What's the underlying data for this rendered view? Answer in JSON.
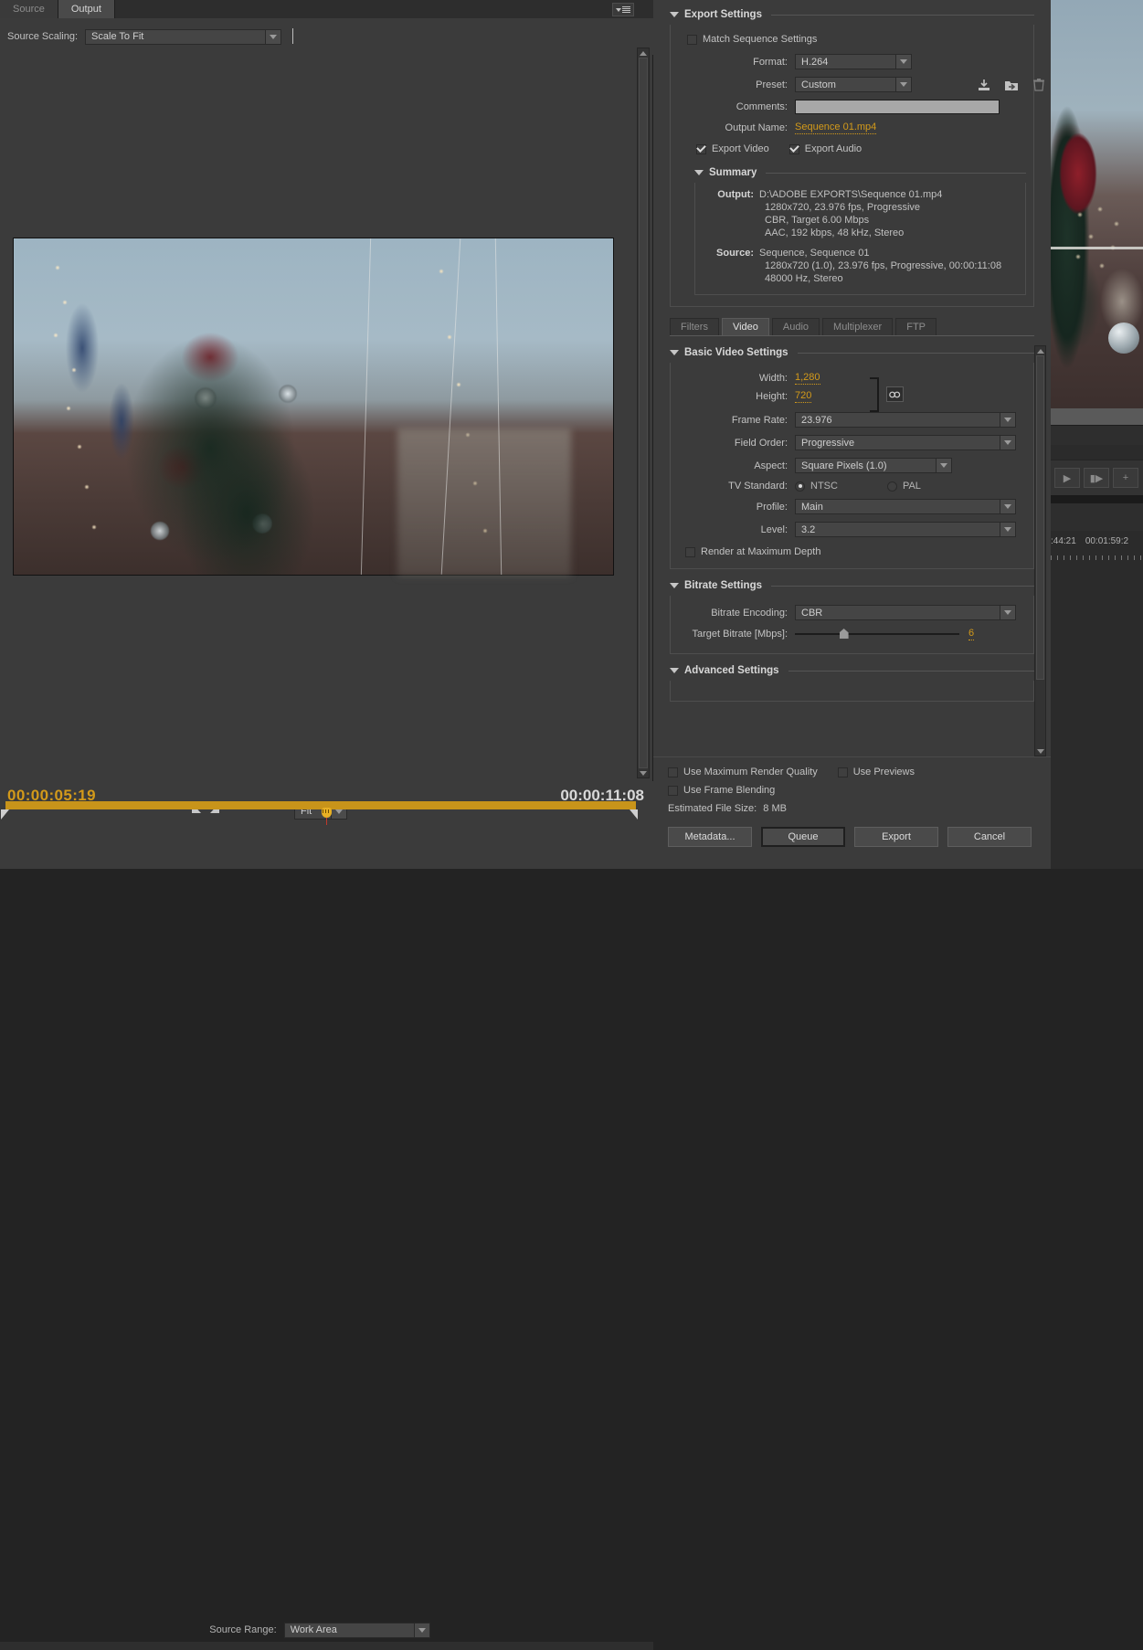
{
  "preview_panel": {
    "tabs": [
      {
        "label": "Source",
        "active": false
      },
      {
        "label": "Output",
        "active": true
      }
    ],
    "panel_menu_icon": "panel-menu-icon",
    "source_scaling_label": "Source Scaling:",
    "source_scaling_value": "Scale To Fit",
    "current_timecode": "00:00:05:19",
    "duration_timecode": "00:00:11:08",
    "zoom_level": "Fit",
    "source_range_label": "Source Range:",
    "source_range_value": "Work Area"
  },
  "export_settings": {
    "title": "Export Settings",
    "match_sequence_label": "Match Sequence Settings",
    "match_sequence_checked": false,
    "format_label": "Format:",
    "format_value": "H.264",
    "preset_label": "Preset:",
    "preset_value": "Custom",
    "preset_icons": [
      "save-preset-icon",
      "import-preset-icon",
      "delete-preset-icon"
    ],
    "comments_label": "Comments:",
    "comments_value": "",
    "output_name_label": "Output Name:",
    "output_name_value": "Sequence 01.mp4",
    "export_video_label": "Export Video",
    "export_video_checked": true,
    "export_audio_label": "Export Audio",
    "export_audio_checked": true
  },
  "summary": {
    "title": "Summary",
    "output_key": "Output:",
    "output_lines": [
      "D:\\ADOBE EXPORTS\\Sequence 01.mp4",
      "1280x720, 23.976 fps, Progressive",
      "CBR, Target 6.00 Mbps",
      "AAC, 192 kbps, 48 kHz, Stereo"
    ],
    "source_key": "Source:",
    "source_lines": [
      "Sequence, Sequence 01",
      "1280x720 (1.0), 23.976 fps, Progressive, 00:00:11:08",
      "48000 Hz, Stereo"
    ]
  },
  "category_tabs": [
    {
      "label": "Filters",
      "active": false
    },
    {
      "label": "Video",
      "active": true
    },
    {
      "label": "Audio",
      "active": false
    },
    {
      "label": "Multiplexer",
      "active": false
    },
    {
      "label": "FTP",
      "active": false
    }
  ],
  "basic_video": {
    "title": "Basic Video Settings",
    "width_label": "Width:",
    "width_value": "1,280",
    "height_label": "Height:",
    "height_value": "720",
    "link_icon": "chain-link-icon",
    "frame_rate_label": "Frame Rate:",
    "frame_rate_value": "23.976",
    "field_order_label": "Field Order:",
    "field_order_value": "Progressive",
    "aspect_label": "Aspect:",
    "aspect_value": "Square Pixels (1.0)",
    "tv_standard_label": "TV Standard:",
    "tv_ntsc_label": "NTSC",
    "tv_pal_label": "PAL",
    "tv_standard_selected": "NTSC",
    "profile_label": "Profile:",
    "profile_value": "Main",
    "level_label": "Level:",
    "level_value": "3.2",
    "render_max_depth_label": "Render at Maximum Depth",
    "render_max_depth_checked": false
  },
  "bitrate": {
    "title": "Bitrate Settings",
    "encoding_label": "Bitrate Encoding:",
    "encoding_value": "CBR",
    "target_label": "Target Bitrate [Mbps]:",
    "target_value": "6"
  },
  "advanced": {
    "title": "Advanced Settings"
  },
  "bottom": {
    "max_render_quality_label": "Use Maximum Render Quality",
    "max_render_quality_checked": false,
    "use_previews_label": "Use Previews",
    "use_previews_checked": false,
    "frame_blending_label": "Use Frame Blending",
    "frame_blending_checked": false,
    "estimated_size_label": "Estimated File Size:",
    "estimated_size_value": "8 MB",
    "buttons": [
      {
        "label": "Metadata...",
        "primary": false
      },
      {
        "label": "Queue",
        "primary": true
      },
      {
        "label": "Export",
        "primary": false
      },
      {
        "label": "Cancel",
        "primary": false
      }
    ]
  },
  "background_app": {
    "timecode_left": ":44:21",
    "timecode_right": "00:01:59:2"
  },
  "colors": {
    "accent_orange": "#d39a1a",
    "panel_bg": "#3b3b3b",
    "scrub_bar": "#c8941a"
  }
}
